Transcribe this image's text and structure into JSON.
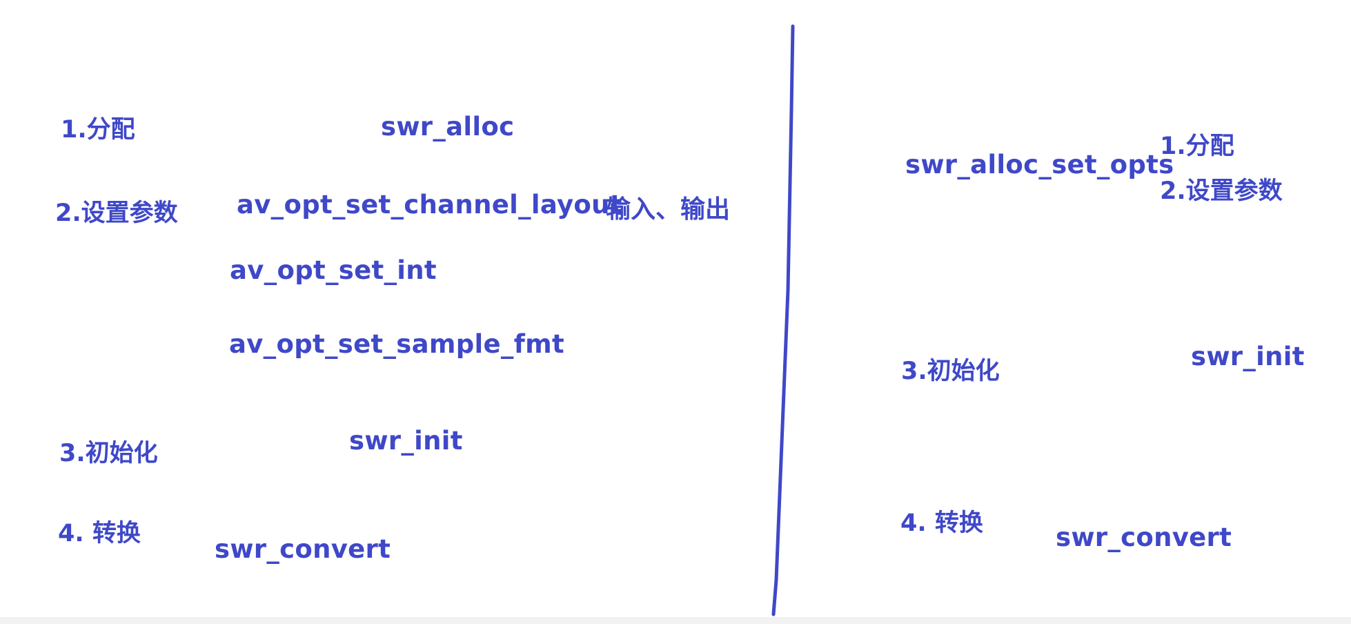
{
  "colors": {
    "ink": "#3f48c8",
    "background": "#ffffff"
  },
  "left": {
    "step1": "1.分配",
    "step2": "2.设置参数",
    "step3": "3.初始化",
    "step4": "4. 转换",
    "fn_alloc": "swr_alloc",
    "fn_channel_layout": "av_opt_set_channel_layout",
    "io_note": "输入、输出",
    "fn_set_int": "av_opt_set_int",
    "fn_sample_fmt": "av_opt_set_sample_fmt",
    "fn_init": "swr_init",
    "fn_convert": "swr_convert"
  },
  "right": {
    "fn_alloc_set_opts": "swr_alloc_set_opts",
    "step1": "1.分配",
    "step2": "2.设置参数",
    "step3": "3.初始化",
    "fn_init": "swr_init",
    "step4": "4. 转换",
    "fn_convert": "swr_convert"
  }
}
